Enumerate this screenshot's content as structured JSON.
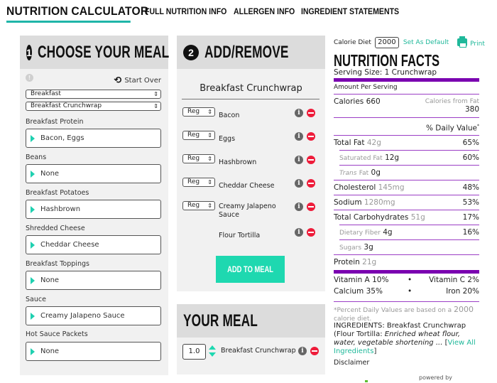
{
  "nav": {
    "title": "NUTRITION CALCULATOR",
    "links": [
      "FULL NUTRITION INFO",
      "ALLERGEN INFO",
      "INGREDIENT STATEMENTS"
    ]
  },
  "choose": {
    "step": "1",
    "title": "CHOOSE YOUR MEAL",
    "start_over": "Start Over",
    "category": "Breakfast",
    "item": "Breakfast Crunchwrap",
    "fields": [
      {
        "label": "Breakfast Protein",
        "value": "Bacon, Eggs"
      },
      {
        "label": "Beans",
        "value": "None"
      },
      {
        "label": "Breakfast Potatoes",
        "value": "Hashbrown"
      },
      {
        "label": "Shredded Cheese",
        "value": "Cheddar Cheese"
      },
      {
        "label": "Breakfast Toppings",
        "value": "None"
      },
      {
        "label": "Sauce",
        "value": "Creamy Jalapeno Sauce"
      },
      {
        "label": "Hot Sauce Packets",
        "value": "None"
      }
    ]
  },
  "addremove": {
    "step": "2",
    "title": "ADD/REMOVE",
    "item_title": "Breakfast Crunchwrap",
    "ingredients": [
      {
        "amount": "Reg",
        "name": "Bacon"
      },
      {
        "amount": "Reg",
        "name": "Eggs"
      },
      {
        "amount": "Reg",
        "name": "Hashbrown"
      },
      {
        "amount": "Reg",
        "name": "Cheddar Cheese"
      },
      {
        "amount": "Reg",
        "name": "Creamy Jalapeno Sauce"
      },
      {
        "amount": "",
        "name": "Flour Tortilla"
      }
    ],
    "add_button": "ADD TO MEAL"
  },
  "meal": {
    "title": "YOUR MEAL",
    "items": [
      {
        "qty": "1.0",
        "name": "Breakfast Crunchwrap"
      }
    ]
  },
  "nutrition": {
    "calorie_diet_label": "Calorie Diet",
    "calorie_diet_value": "2000",
    "set_default": "Set As Default",
    "print": "Print",
    "title": "NUTRITION FACTS",
    "serving_size": "Serving Size: 1 Crunchwrap",
    "amount_per_serving": "Amount Per Serving",
    "calories_label": "Calories",
    "calories": "660",
    "calories_from_fat_label": "Calories from Fat",
    "calories_from_fat": "380",
    "daily_value_label": "% Daily Value",
    "rows": [
      {
        "label": "Total Fat",
        "amount": "42g",
        "pct": "65%"
      },
      {
        "label": "Saturated Fat",
        "amount": "12g",
        "pct": "60%"
      },
      {
        "label": "Trans",
        "label2": "Fat",
        "amount": "0g",
        "pct": ""
      },
      {
        "label": "Cholesterol",
        "amount": "145mg",
        "pct": "48%"
      },
      {
        "label": "Sodium",
        "amount": "1280mg",
        "pct": "53%"
      },
      {
        "label": "Total Carbohydrates",
        "amount": "51g",
        "pct": "17%"
      },
      {
        "label": "Dietary Fiber",
        "amount": "4g",
        "pct": "16%"
      },
      {
        "label": "Sugars",
        "amount": "3g",
        "pct": ""
      },
      {
        "label": "Protein",
        "amount": "21g",
        "pct": ""
      }
    ],
    "vitamins": {
      "vitamin_a": "Vitamin A 10%",
      "vitamin_c": "Vitamin C 2%",
      "calcium": "Calcium 35%",
      "iron": "Iron 20%",
      "bullet": "•"
    },
    "footnote_prefix": "*Percent Daily Values are based on a",
    "footnote_value": "2000",
    "footnote_suffix": "calorie diet.",
    "ingredients_prefix": "INGREDIENTS: Breakfast Crunchwrap (Flour Tortilla:",
    "ingredients_italic": "Enriched wheat flour, water, vegetable shortening ...",
    "view_all_open": "[",
    "view_all": "View All Ingredients",
    "view_all_close": "]",
    "disclaimer": "Disclaimer",
    "powered_by": "powered by"
  }
}
